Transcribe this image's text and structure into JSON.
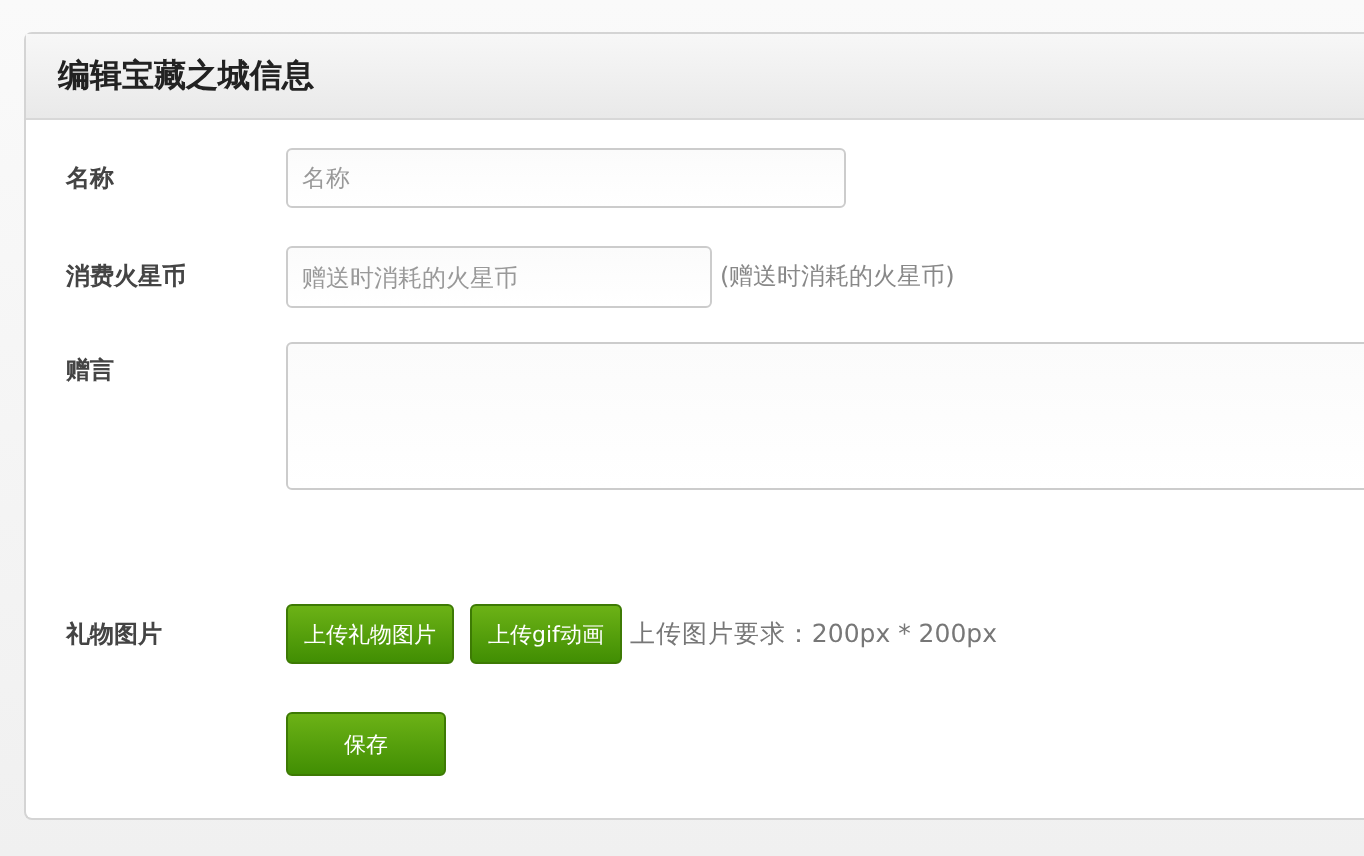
{
  "panel": {
    "title": "编辑宝藏之城信息"
  },
  "fields": [
    {
      "kind": "text",
      "label": "名称",
      "placeholder": "名称"
    },
    {
      "kind": "coins",
      "label": "消费火星币",
      "placeholder": "赠送时消耗的火星币",
      "hint": "(赠送时消耗的火星币)"
    },
    {
      "kind": "textarea",
      "label": "赠言"
    },
    {
      "kind": "upload",
      "label": "礼物图片",
      "buttons": [
        "上传礼物图片",
        "上传gif动画"
      ],
      "hint": "上传图片要求：200px * 200px"
    }
  ],
  "save_button": "保存"
}
